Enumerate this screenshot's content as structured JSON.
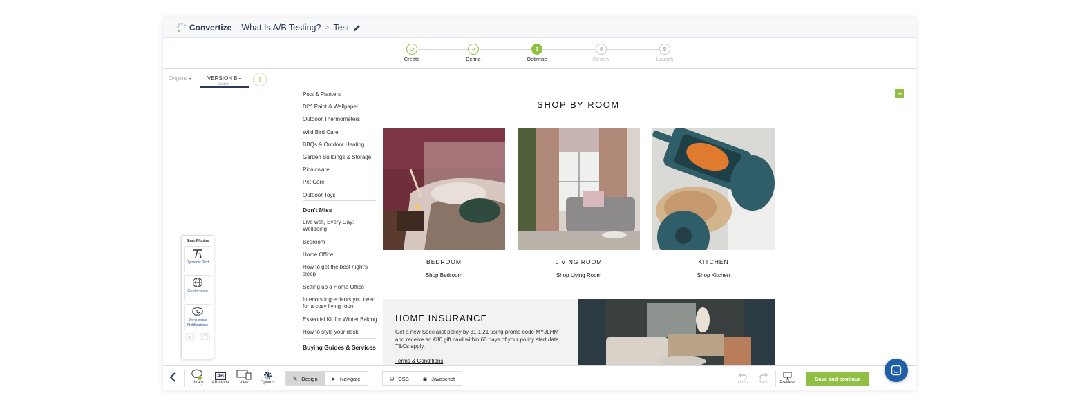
{
  "header": {
    "brand": "Convertize",
    "crumb_project": "What Is A/B Testing?",
    "crumb_sep": ">",
    "crumb_test": "Test"
  },
  "stepper": {
    "steps": [
      {
        "label": "Create",
        "num": "",
        "state": "done"
      },
      {
        "label": "Define",
        "num": "",
        "state": "done"
      },
      {
        "label": "Optimise",
        "num": "3",
        "state": "active"
      },
      {
        "label": "Review",
        "num": "4",
        "state": "future"
      },
      {
        "label": "Launch",
        "num": "5",
        "state": "future"
      }
    ]
  },
  "versions": {
    "original": "Original",
    "version_b": "VERSION B",
    "version_b_sub": "Custom",
    "add": "+"
  },
  "menu": {
    "items_1": [
      "Pots & Planters",
      "DIY, Paint & Wallpaper",
      "Outdoor Thermometers",
      "Wild Bird Care",
      "BBQs & Outdoor Heating",
      "Garden Buildings & Storage",
      "Picnicware",
      "Pet Care",
      "Outdoor Toys"
    ],
    "heading_2": "Don't Miss",
    "items_2": [
      "Live well, Every Day: Wellbeing",
      "Bedroom",
      "Home Office",
      "How to get the best night's sleep",
      "Setting up a Home Office",
      "Interiors ingredients you need for a cosy living room",
      "Essential Kit for Winter Baking",
      "How to style your desk"
    ],
    "heading_3": "Buying Guides & Services"
  },
  "shop": {
    "title": "SHOP BY ROOM",
    "rooms": [
      {
        "name": "BEDROOM",
        "link": "Shop Bedroom"
      },
      {
        "name": "LIVING ROOM",
        "link": "Shop Living Room"
      },
      {
        "name": "KITCHEN",
        "link": "Shop Kitchen"
      }
    ]
  },
  "insurance": {
    "title": "HOME INSURANCE",
    "text": "Get a new Specialist policy by 31.1.21 using promo code MYJLHM and receive an £80 gift card within 60 days of your policy start date. T&Cs apply.",
    "link": "Terms & Conditions"
  },
  "plugins": {
    "heading": "SmartPlugins",
    "items": [
      {
        "label": "Dynamic Text",
        "icon": "dynamic-text-icon"
      },
      {
        "label": "Geolocation",
        "icon": "globe-icon"
      },
      {
        "label": "Persuasive Notifications",
        "icon": "brain-icon"
      }
    ]
  },
  "toolbar": {
    "library": "Library",
    "ab_mode": "AB mode",
    "ab_badge": "AB",
    "view": "View",
    "options": "Options",
    "design": "Design",
    "navigate": "Navigate",
    "css": "CSS",
    "javascript": "Javascript",
    "undo": "Undo",
    "redo": "Redo",
    "preview": "Preview",
    "save": "Save and continue"
  },
  "colors": {
    "accent": "#8fc043",
    "brand_dark": "#2b3a55",
    "chat": "#1f5fa8"
  }
}
